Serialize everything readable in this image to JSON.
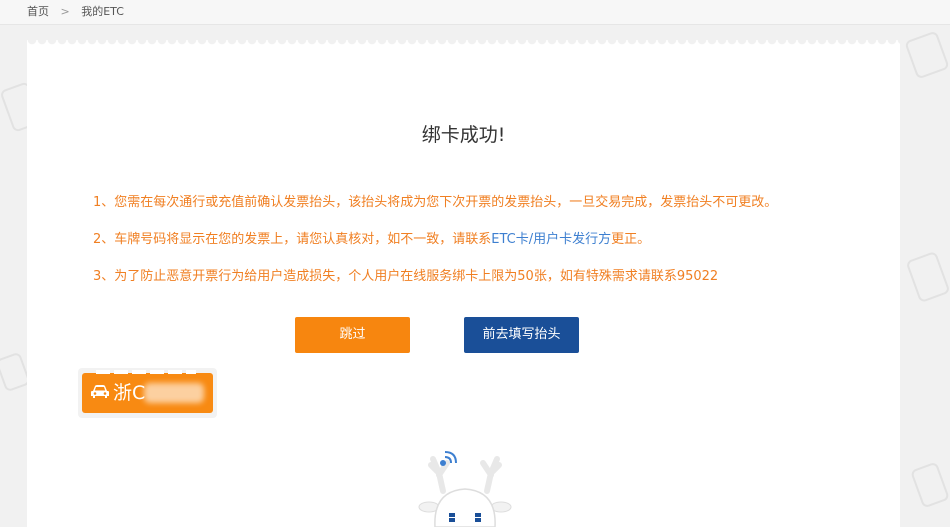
{
  "breadcrumb": {
    "home": "首页",
    "separator": ">",
    "current": "我的ETC"
  },
  "page": {
    "title": "绑卡成功!"
  },
  "notes": {
    "n1": "1、您需在每次通行或充值前确认发票抬头，该抬头将成为您下次开票的发票抬头，一旦交易完成，发票抬头不可更改。",
    "n2_prefix": "2、车牌号码将显示在您的发票上，请您认真核对，如不一致，请联系",
    "n2_link": "ETC卡/用户卡发行方",
    "n2_suffix": "更正。",
    "n3": "3、为了防止恶意开票行为给用户造成损失，个人用户在线服务绑卡上限为50张，如有特殊需求请联系95022"
  },
  "buttons": {
    "skip": "跳过",
    "fill_header": "前去填写抬头"
  },
  "plate": {
    "text": "浙C",
    "icon": "car-icon"
  },
  "colors": {
    "accent_orange": "#f7860f",
    "primary_blue": "#1a4f98",
    "note_text": "#f07f22",
    "link_blue": "#3d7fd0"
  }
}
